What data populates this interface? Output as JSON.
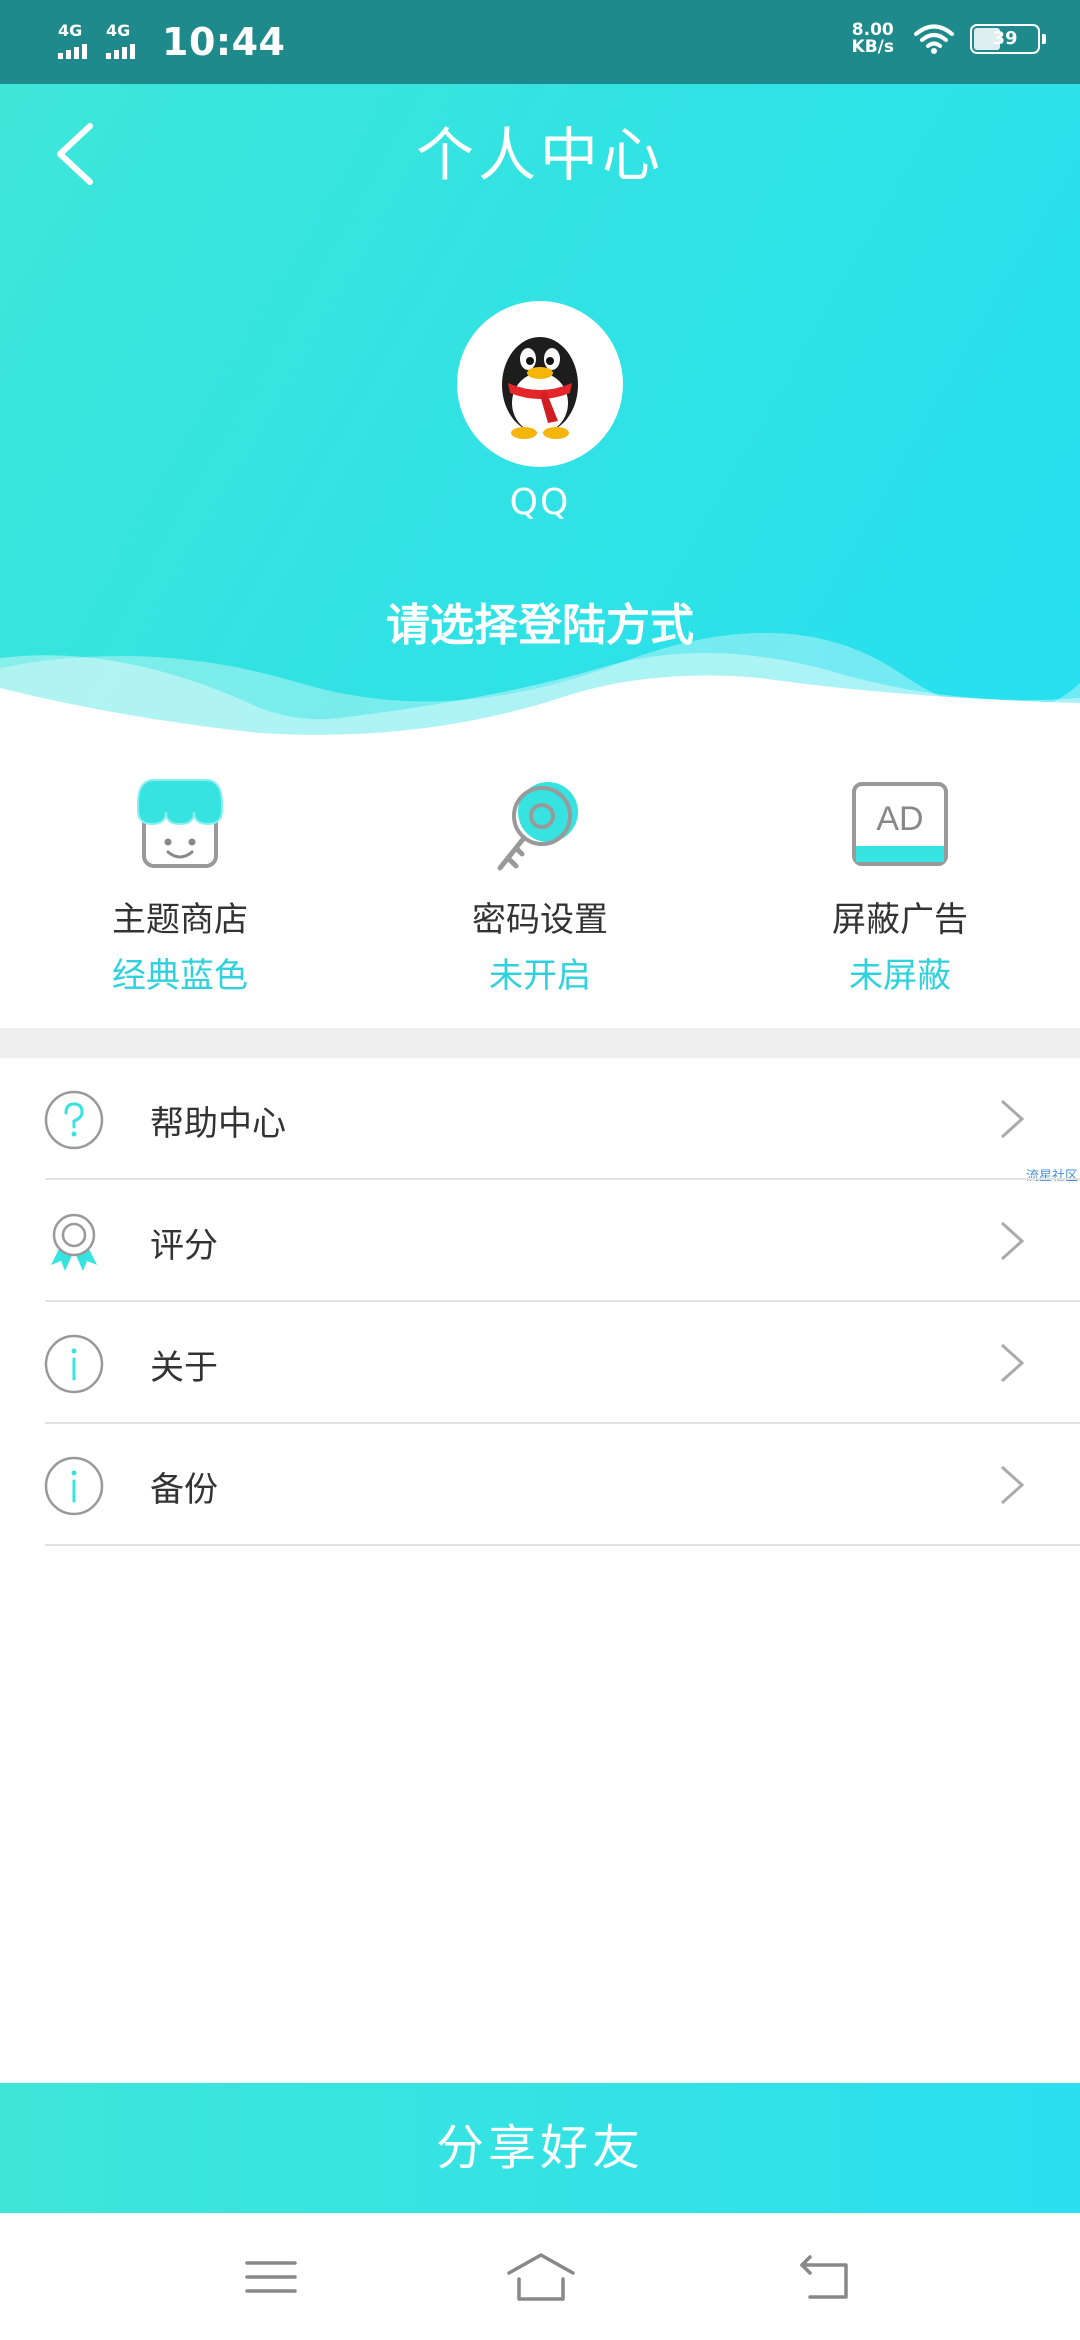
{
  "status_bar": {
    "network_1": "4G",
    "network_2": "4G",
    "time": "10:44",
    "speed_value": "8.00",
    "speed_unit": "KB/s",
    "battery": "39"
  },
  "header": {
    "title": "个人中心",
    "account_name": "QQ",
    "login_prompt": "请选择登陆方式"
  },
  "quick_actions": [
    {
      "label": "主题商店",
      "value": "经典蓝色",
      "icon": "store-icon"
    },
    {
      "label": "密码设置",
      "value": "未开启",
      "icon": "key-icon"
    },
    {
      "label": "屏蔽广告",
      "value": "未屏蔽",
      "icon": "ad-icon"
    }
  ],
  "ad_icon_text": "AD",
  "menu": [
    {
      "label": "帮助中心",
      "icon": "help-icon"
    },
    {
      "label": "评分",
      "icon": "medal-icon"
    },
    {
      "label": "关于",
      "icon": "info-icon"
    },
    {
      "label": "备份",
      "icon": "info-icon"
    }
  ],
  "watermark": "流星社区",
  "share_button": "分享好友",
  "colors": {
    "accent": "#2fd2dc",
    "status_bar": "#1f8a8c",
    "gradient_start": "#3ee6d8",
    "gradient_end": "#26dff0"
  }
}
